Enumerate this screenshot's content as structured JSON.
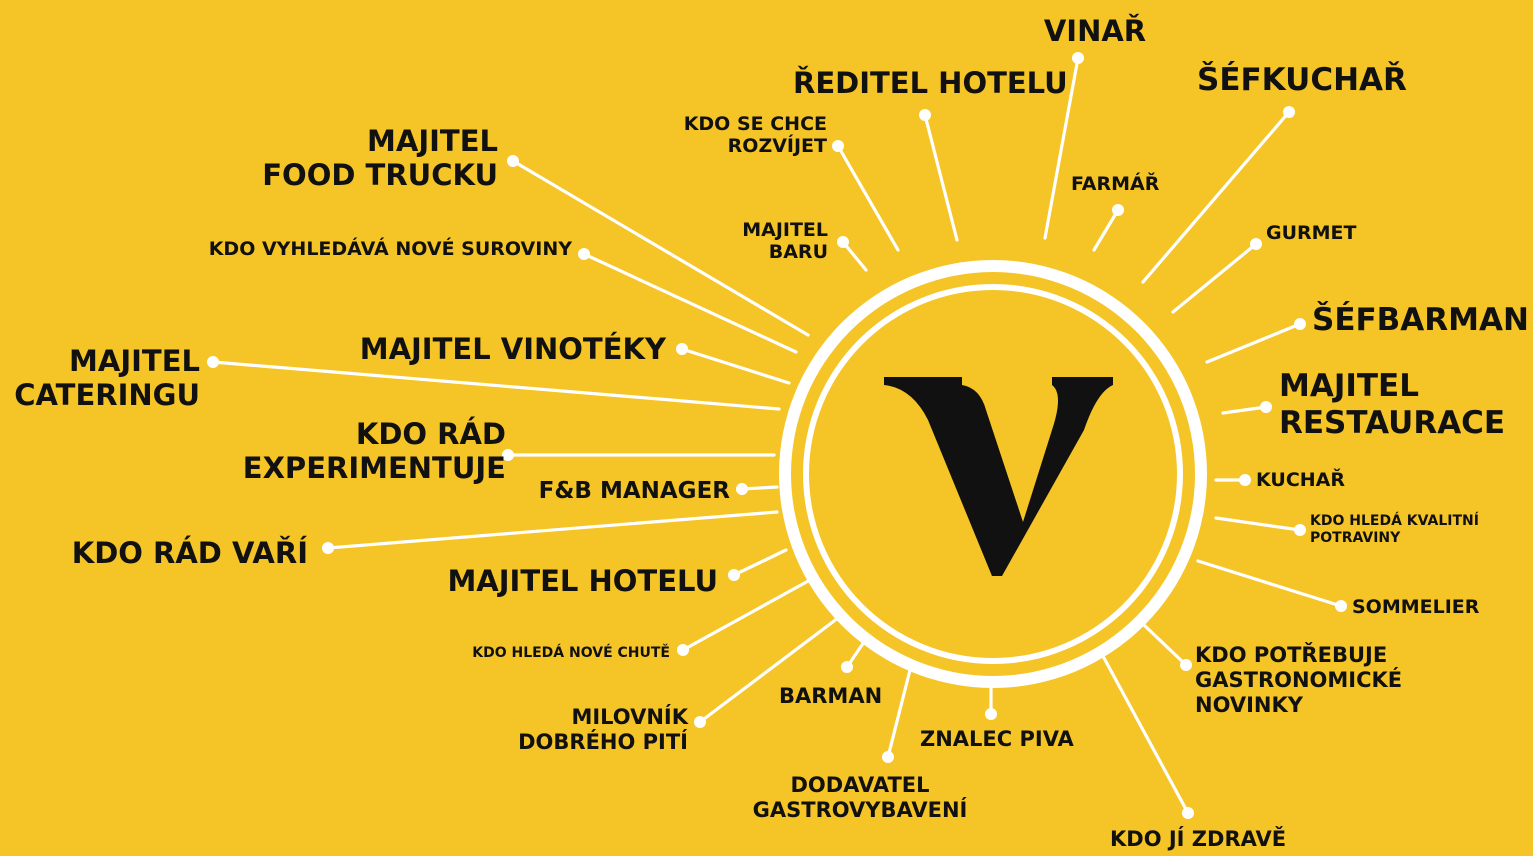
{
  "colors": {
    "background": "#F5C427",
    "lines": "#FFFFFF",
    "text": "#111111",
    "logo": "#111111"
  },
  "center_logo": {
    "letter": "V",
    "icon": "v-logo-icon"
  },
  "labels": [
    {
      "id": "vinar",
      "text": "VINAŘ"
    },
    {
      "id": "reditel-hotelu",
      "text": "ŘEDITEL HOTELU"
    },
    {
      "id": "sefkuchar",
      "text": "ŠÉFKUCHAŘ"
    },
    {
      "id": "kdo-se-chce-rozvijet",
      "text": "KDO SE CHCE\nROZVÍJET"
    },
    {
      "id": "farmar",
      "text": "FARMÁŘ"
    },
    {
      "id": "majitel-food-trucku",
      "text": "MAJITEL\nFOOD TRUCKU"
    },
    {
      "id": "majitel-baru",
      "text": "MAJITEL\nBARU"
    },
    {
      "id": "gurmet",
      "text": "GURMET"
    },
    {
      "id": "kdo-vyhledava-nove-suroviny",
      "text": "KDO VYHLEDÁVÁ NOVÉ SUROVINY"
    },
    {
      "id": "sefbarman",
      "text": "ŠÉFBARMAN"
    },
    {
      "id": "majitel-vinoteky",
      "text": "MAJITEL VINOTÉKY"
    },
    {
      "id": "majitel-cateringu",
      "text": "MAJITEL\nCATERINGU"
    },
    {
      "id": "majitel-restaurace",
      "text": "MAJITEL\nRESTAURACE"
    },
    {
      "id": "kdo-rad-experimentuje",
      "text": "KDO RÁD\nEXPERIMENTUJE"
    },
    {
      "id": "fb-manager",
      "text": "F&B MANAGER"
    },
    {
      "id": "kuchar",
      "text": "KUCHAŘ"
    },
    {
      "id": "kdo-hleda-kvalitni-potraviny",
      "text": "KDO HLEDÁ KVALITNÍ\nPOTRAVINY"
    },
    {
      "id": "kdo-rad-vari",
      "text": "KDO RÁD VAŘÍ"
    },
    {
      "id": "majitel-hotelu",
      "text": "MAJITEL HOTELU"
    },
    {
      "id": "sommelier",
      "text": "SOMMELIER"
    },
    {
      "id": "kdo-hleda-nove-chute",
      "text": "KDO HLEDÁ NOVÉ CHUTĚ"
    },
    {
      "id": "kdo-potrebuje-gastronomicke-novinky",
      "text": "KDO POTŘEBUJE\nGASTRONOMICKÉ\nNOVINKY"
    },
    {
      "id": "milovnik-dobreho-piti",
      "text": "MILOVNÍK\nDOBRÉHO PITÍ"
    },
    {
      "id": "barman",
      "text": "BARMAN"
    },
    {
      "id": "znalec-piva",
      "text": "ZNALEC PIVA"
    },
    {
      "id": "dodavatel-gastrovybaveni",
      "text": "DODAVATEL\nGASTROVYBAVENÍ"
    },
    {
      "id": "kdo-ji-zdrave",
      "text": "KDO JÍ ZDRAVĚ"
    }
  ]
}
